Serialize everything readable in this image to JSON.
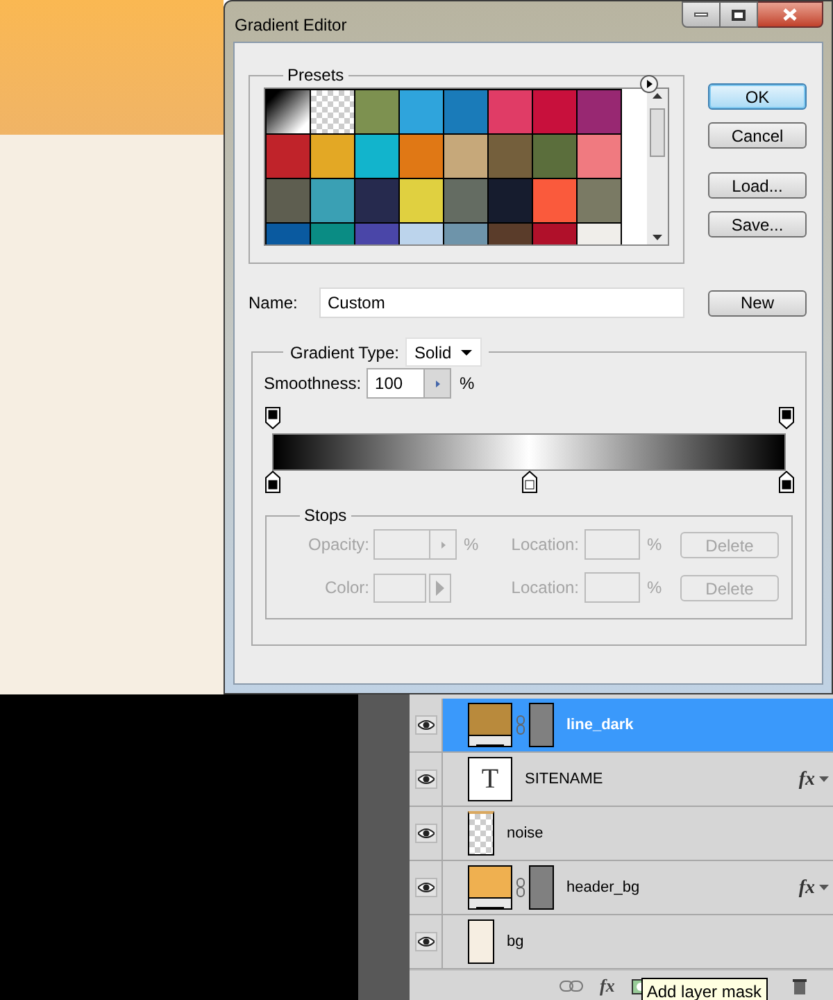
{
  "window": {
    "title": "Gradient Editor"
  },
  "presets": {
    "label": "Presets",
    "swatches": [
      {
        "kind": "gradient",
        "color": "#000000"
      },
      {
        "kind": "checker",
        "color": "#cccccc"
      },
      {
        "kind": "solid",
        "color": "#7d9150"
      },
      {
        "kind": "solid",
        "color": "#2fa4dc"
      },
      {
        "kind": "solid",
        "color": "#1a7bb9"
      },
      {
        "kind": "solid",
        "color": "#e03c66"
      },
      {
        "kind": "solid",
        "color": "#c8103c"
      },
      {
        "kind": "solid",
        "color": "#982872"
      },
      {
        "kind": "solid",
        "color": "#c0232a"
      },
      {
        "kind": "solid",
        "color": "#e3a825"
      },
      {
        "kind": "solid",
        "color": "#12b4cc"
      },
      {
        "kind": "solid",
        "color": "#e07815"
      },
      {
        "kind": "solid",
        "color": "#c6a87a"
      },
      {
        "kind": "solid",
        "color": "#745f3c"
      },
      {
        "kind": "solid",
        "color": "#5b6e3c"
      },
      {
        "kind": "solid",
        "color": "#f07a80"
      },
      {
        "kind": "solid",
        "color": "#5e5e50"
      },
      {
        "kind": "solid",
        "color": "#3aa0b4"
      },
      {
        "kind": "solid",
        "color": "#262a4e"
      },
      {
        "kind": "solid",
        "color": "#e0d040"
      },
      {
        "kind": "solid",
        "color": "#646c62"
      },
      {
        "kind": "solid",
        "color": "#161c2e"
      },
      {
        "kind": "solid",
        "color": "#fa5a3c"
      },
      {
        "kind": "solid",
        "color": "#7a7a64"
      },
      {
        "kind": "solid",
        "color": "#0a5aa0"
      },
      {
        "kind": "solid",
        "color": "#0a8c84"
      },
      {
        "kind": "solid",
        "color": "#4a46a8"
      },
      {
        "kind": "solid",
        "color": "#bcd4ec"
      },
      {
        "kind": "solid",
        "color": "#6e94aa"
      },
      {
        "kind": "solid",
        "color": "#5a3c2a"
      },
      {
        "kind": "solid",
        "color": "#b0102a"
      },
      {
        "kind": "solid",
        "color": "#f0eeea"
      }
    ]
  },
  "buttons": [
    {
      "label": "OK",
      "default": true
    },
    {
      "label": "Cancel",
      "default": false
    },
    {
      "label": "Load...",
      "default": false
    },
    {
      "label": "Save...",
      "default": false
    }
  ],
  "name": {
    "label": "Name:",
    "value": "Custom",
    "button": "New"
  },
  "gradient_type": {
    "label": "Gradient Type:",
    "value": "Solid"
  },
  "smoothness": {
    "label": "Smoothness:",
    "value": "100",
    "unit": "%"
  },
  "opacity_stops": [
    {
      "level": 0
    },
    {
      "level": 1
    }
  ],
  "color_stops": [
    {
      "level": 0,
      "color": "#000000",
      "selected": false
    },
    {
      "level": 0.5,
      "color": "#ffffff",
      "selected": false
    },
    {
      "level": 1,
      "color": "#000000",
      "selected": false
    }
  ],
  "stops": {
    "label": "Stops",
    "rows": [
      {
        "kind": "opacity",
        "label": "Opacity:",
        "unit": "%",
        "location_label": "Location:",
        "location_unit": "%",
        "button": "Delete",
        "disabled": true
      },
      {
        "kind": "color",
        "label": "Color:",
        "location_label": "Location:",
        "location_unit": "%",
        "button": "Delete",
        "disabled": true
      }
    ]
  },
  "layers": [
    {
      "name": "line_dark",
      "selected": true,
      "visible": true,
      "kind": "fill",
      "color": "#b98a3c",
      "mask": true
    },
    {
      "name": "SITENAME",
      "selected": false,
      "visible": true,
      "kind": "text",
      "glyph": "T",
      "fx": "fx"
    },
    {
      "name": "noise",
      "selected": false,
      "visible": true,
      "kind": "transparent"
    },
    {
      "name": "header_bg",
      "selected": false,
      "visible": true,
      "kind": "fill",
      "color": "#efb050",
      "mask": true,
      "fx": "fx"
    },
    {
      "name": "bg",
      "selected": false,
      "visible": true,
      "kind": "plain",
      "color": "#f6eee2"
    }
  ],
  "toolbar": {
    "fx": "fx",
    "tooltip": "Add layer mask"
  }
}
